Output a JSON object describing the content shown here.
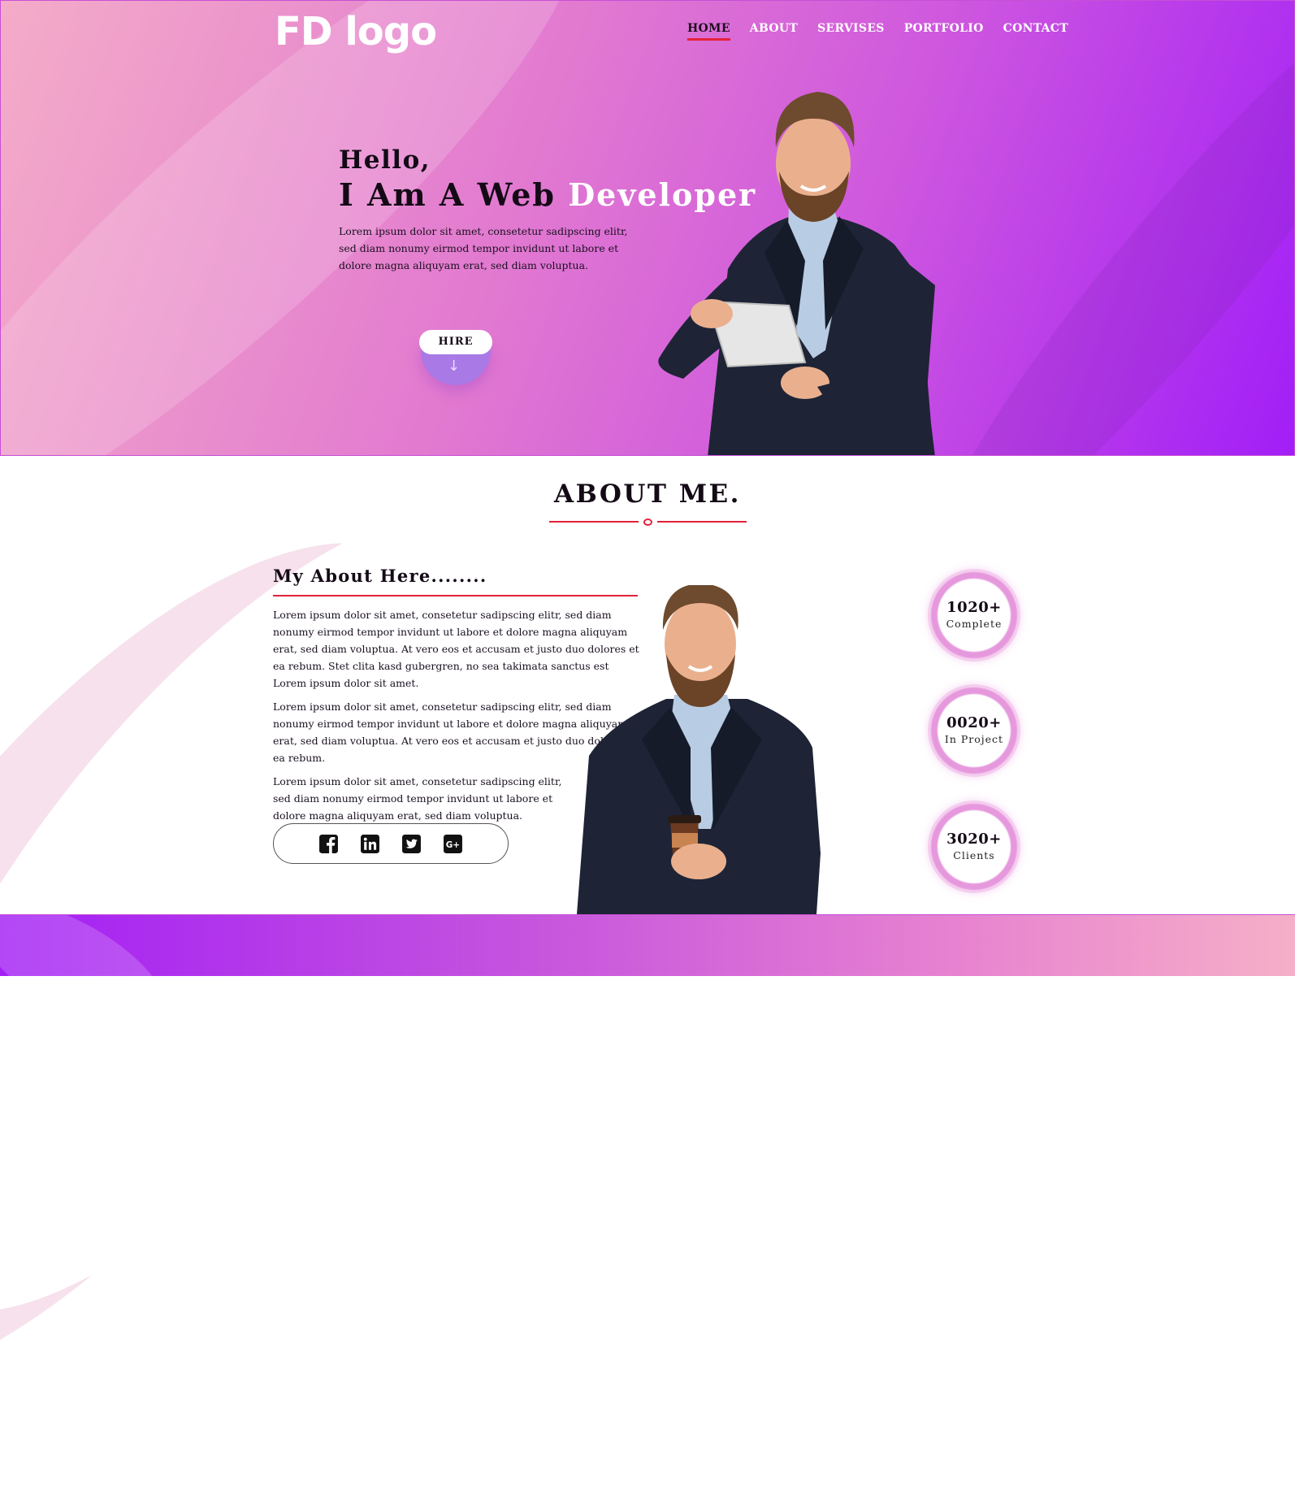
{
  "header": {
    "logo_text": "FD logo",
    "nav": [
      {
        "label": "HOME",
        "active": true
      },
      {
        "label": "ABOUT",
        "active": false
      },
      {
        "label": "SERVISES",
        "active": false
      },
      {
        "label": "PORTFOLIO",
        "active": false
      },
      {
        "label": "CONTACT",
        "active": false
      }
    ]
  },
  "hero": {
    "greeting": "Hello,",
    "headline_lead": "I Am A Web ",
    "headline_accent": "Developer",
    "description": "Lorem ipsum dolor sit amet, consetetur sadipscing elitr, sed diam nonumy eirmod tempor invidunt ut labore et dolore magna aliquyam erat, sed diam voluptua.",
    "hire_label": "HIRE",
    "hire_icon": "arrow-down-icon"
  },
  "about": {
    "title": "ABOUT ME.",
    "subtitle": "My About Here........",
    "paragraphs": [
      "Lorem ipsum dolor sit amet, consetetur sadipscing elitr, sed diam nonumy eirmod tempor invidunt ut labore et dolore magna aliquyam erat, sed diam voluptua. At vero eos et accusam et justo duo dolores et ea rebum. Stet clita kasd gubergren, no sea takimata sanctus est Lorem ipsum dolor sit amet.",
      "Lorem ipsum dolor sit amet, consetetur sadipscing elitr, sed diam nonumy eirmod tempor invidunt ut labore et dolore magna aliquyam erat, sed diam voluptua. At vero eos et accusam et justo duo dolores et ea rebum.",
      "Lorem ipsum dolor sit amet, consetetur sadipscing elitr, sed diam nonumy eirmod tempor invidunt ut labore et dolore magna aliquyam erat, sed diam voluptua."
    ],
    "social": [
      "facebook-icon",
      "linkedin-icon",
      "twitter-icon",
      "google-plus-icon"
    ],
    "stats": [
      {
        "value": "1020+",
        "label": "Complete"
      },
      {
        "value": "0020+",
        "label": "In Project"
      },
      {
        "value": "3020+",
        "label": "Clients"
      }
    ]
  },
  "colors": {
    "accent_red": "#e5213b",
    "hero_gradient_start": "#f4acc8",
    "hero_gradient_end": "#a21ef7",
    "hire_bowl": "#a979e6"
  }
}
